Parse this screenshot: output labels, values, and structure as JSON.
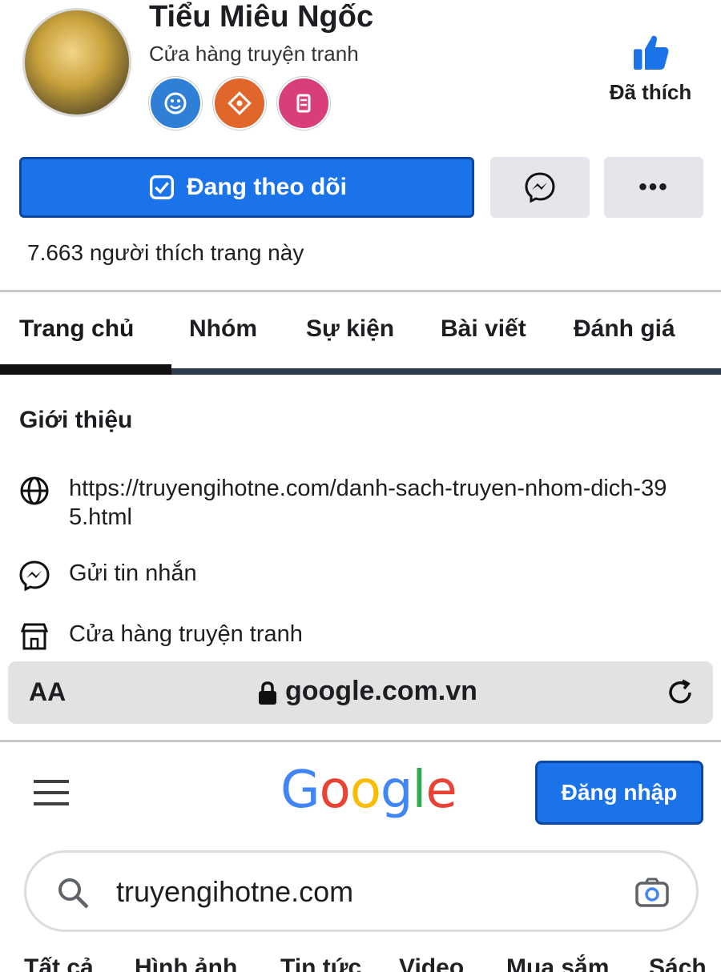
{
  "profile": {
    "name": "Tiểu Miêu Ngốc",
    "category": "Cửa hàng truyện tranh",
    "liked_label": "Đã thích",
    "follow_label": "Đang theo dõi",
    "more_label": "•••",
    "likes_count": "7.663 người thích trang này",
    "stickers": [
      "blue-sticker-icon",
      "orange-sticker-icon",
      "pink-sticker-icon"
    ]
  },
  "tabs": [
    "Trang chủ",
    "Nhóm",
    "Sự kiện",
    "Bài viết",
    "Đánh giá"
  ],
  "intro": {
    "title": "Giới thiệu",
    "website": "https://truyengihotne.com/danh-sach-truyen-nhom-dich-395.html",
    "message": "Gửi tin nhắn",
    "category": "Cửa hàng truyện tranh"
  },
  "browser": {
    "text_size": "AA",
    "url": "google.com.vn"
  },
  "google": {
    "logo": [
      "G",
      "o",
      "o",
      "g",
      "l",
      "e"
    ],
    "signin_label": "Đăng nhập",
    "search_value": "truyengihotne.com",
    "tabs": [
      "Tất cả",
      "Hình ảnh",
      "Tin tức",
      "Video",
      "Mua sắm",
      "Sách"
    ]
  },
  "colors": {
    "accent": "#1a73e8",
    "google_blue": "#4285f4",
    "google_red": "#ea4335",
    "google_yellow": "#fbbc05",
    "google_green": "#34a853"
  }
}
